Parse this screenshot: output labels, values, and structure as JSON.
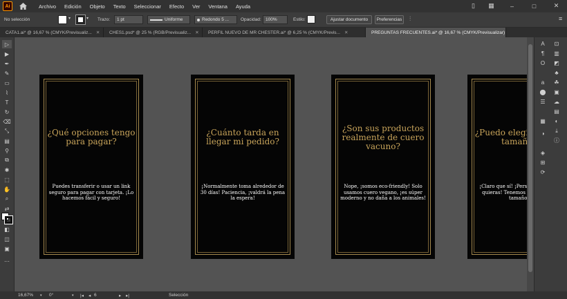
{
  "app": {
    "logo": "Ai",
    "menu": [
      "Archivo",
      "Edición",
      "Objeto",
      "Texto",
      "Seleccionar",
      "Efecto",
      "Ver",
      "Ventana",
      "Ayuda"
    ]
  },
  "control_bar": {
    "selection": "No selección",
    "stroke_label": "Trazo:",
    "stroke_weight": "1 pt",
    "stroke_profile": "Uniforme",
    "brush": "Redondo 5 ...",
    "opacity_label": "Opacidad:",
    "opacity_value": "100%",
    "style_label": "Estilo:",
    "fit_document": "Ajustar documento",
    "preferences": "Preferencias"
  },
  "tabs": [
    {
      "label": "CATA1.ai* @ 16,67 % (CMYK/Previsualiz...",
      "active": false
    },
    {
      "label": "CHES1.psd* @ 25 % (RGB/Previsualiz...",
      "active": false
    },
    {
      "label": "PERFIL NUEVO DE MR CHESTER.ai* @ 6,25 % (CMYK/Previs...",
      "active": false
    },
    {
      "label": "PREGUNTAS FRECUENTES.ai* @ 16,67 % (CMYK/Previsualizar)",
      "active": true
    }
  ],
  "artboards": [
    {
      "title": "¿Qué opciones tengo para pagar?",
      "body": "Puedes transferir o usar un link seguro para pagar con tarjeta. ¡Lo hacemos fácil y seguro!"
    },
    {
      "title": "¿Cuánto tarda en llegar mi pedido?",
      "body": "¡Normalmente toma alrededor de 30 días! Paciencia, ¡valdrá la pena la espera!"
    },
    {
      "title": "¿Son sus productos realmente de cuero vacuno?",
      "body": "Nope, ¡somos eco-friendly! Solo usamos cuero vegano, ¡es súper moderno y no daña a los animales!"
    },
    {
      "title": "¿Puedo elegir color y tamaño?",
      "body": "¡Claro que sí! ¡Personaliza como quieras! Tenemos de colores y tamaños"
    }
  ],
  "status": {
    "zoom": "16,67%",
    "rotation": "0°",
    "artboard_number": "6",
    "tool": "Selección"
  },
  "colors": {
    "gold": "#c8a45a",
    "artboard_bg": "#050505",
    "canvas": "#535353"
  }
}
